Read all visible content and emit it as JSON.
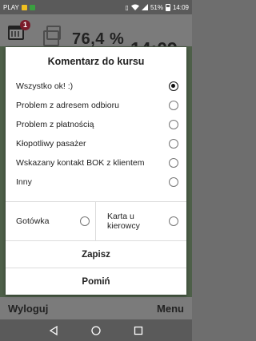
{
  "status_bar": {
    "carrier": "PLAY",
    "battery_percent": "51%",
    "time": "14:09"
  },
  "app_header": {
    "notification_count": "1",
    "percent": "76,4 %",
    "clock": "14:09"
  },
  "dialog": {
    "title": "Komentarz do kursu",
    "options": [
      {
        "label": "Wszystko ok! :)",
        "selected": true
      },
      {
        "label": "Problem z adresem odbioru",
        "selected": false
      },
      {
        "label": "Problem z płatnością",
        "selected": false
      },
      {
        "label": "Kłopotliwy pasażer",
        "selected": false
      },
      {
        "label": "Wskazany kontakt BOK z klientem",
        "selected": false
      },
      {
        "label": "Inny",
        "selected": false
      }
    ],
    "payment": {
      "cash_label": "Gotówka",
      "card_label_line1": "Karta u",
      "card_label_line2": "kierowcy"
    },
    "save_label": "Zapisz",
    "skip_label": "Pomiń"
  },
  "bottom_bar": {
    "logout_label": "Wyloguj",
    "menu_label": "Menu"
  }
}
